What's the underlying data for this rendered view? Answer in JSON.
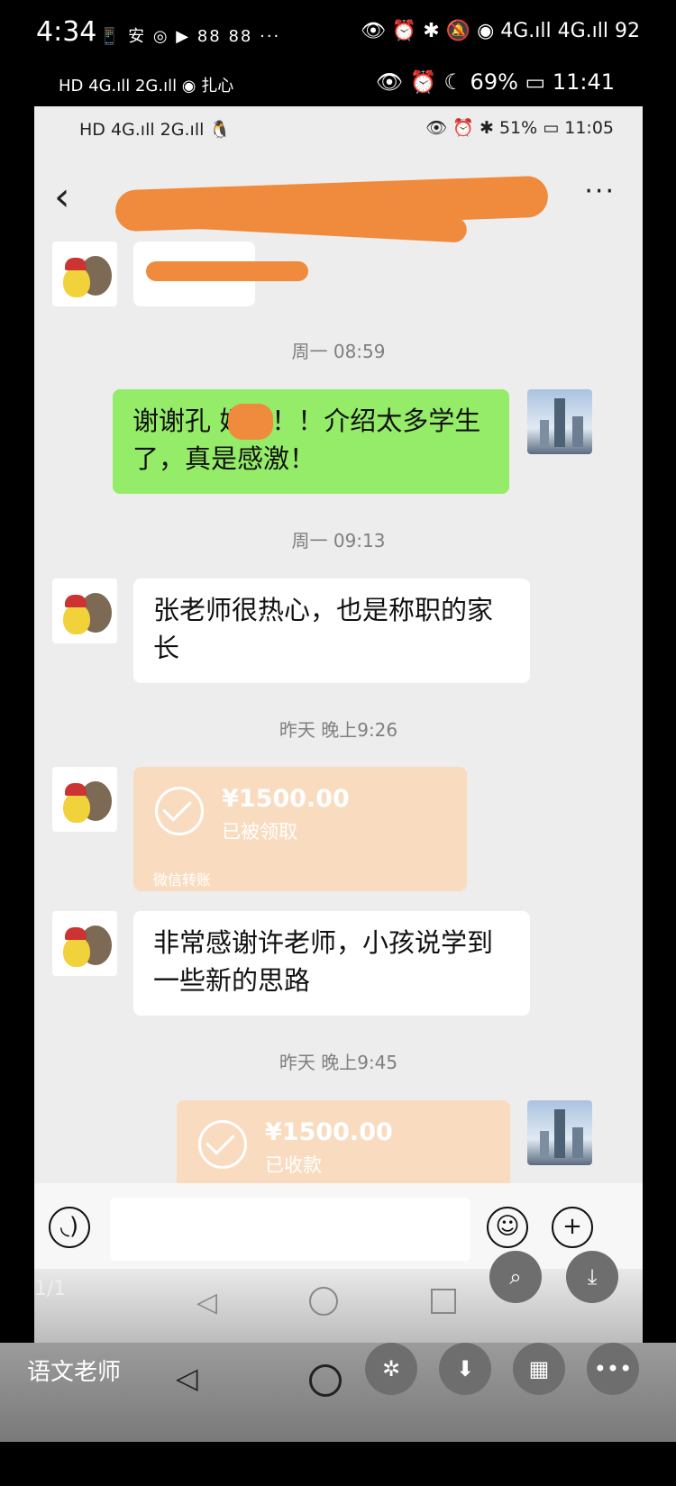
{
  "outer_status_1": {
    "time": "4:34",
    "apps": "📱 安 ◎ ▶ 88 88 ···",
    "right": "👁 ⏰ ✱ 🔕 ◉ 4G.ıll 4G.ıll 92"
  },
  "outer_status_2": {
    "left": "HD 4G.ıll 2G.ıll ◉ 扎心",
    "right": "👁 ⏰ ☾ 69% ▭ 11:41"
  },
  "inner_status": {
    "left": "HD 4G.ıll 2G.ıll 🐧",
    "right": "👁 ⏰ ✱ 51% ▭ 11:05"
  },
  "chat": {
    "back": "‹",
    "more": "···",
    "messages": [
      {
        "side": "left",
        "text": ""
      },
      {
        "timestamp": "周一 08:59"
      },
      {
        "side": "right",
        "text": "谢谢孔      妈妈！！介绍太多学生了，真是感激！"
      },
      {
        "timestamp": "周一 09:13"
      },
      {
        "side": "left",
        "text": "张老师很热心，也是称职的家长"
      },
      {
        "timestamp": "昨天 晚上9:26"
      },
      {
        "side": "left",
        "transfer_amount": "¥1500.00",
        "transfer_status": "已被领取",
        "transfer_footer": "微信转账"
      },
      {
        "side": "left",
        "text": "非常感谢许老师，小孩说学到一些新的思路"
      },
      {
        "timestamp": "昨天 晚上9:45"
      },
      {
        "side": "right",
        "transfer_amount": "¥1500.00",
        "transfer_status": "已收款"
      }
    ]
  },
  "viewer": {
    "page_indicator": "1/1",
    "caption": "语文老师"
  },
  "icons": [
    "voice-icon",
    "emoji-icon",
    "plus-icon",
    "scan-icon",
    "download-icon",
    "share-icon",
    "save-icon",
    "grid-icon",
    "more-icon"
  ]
}
